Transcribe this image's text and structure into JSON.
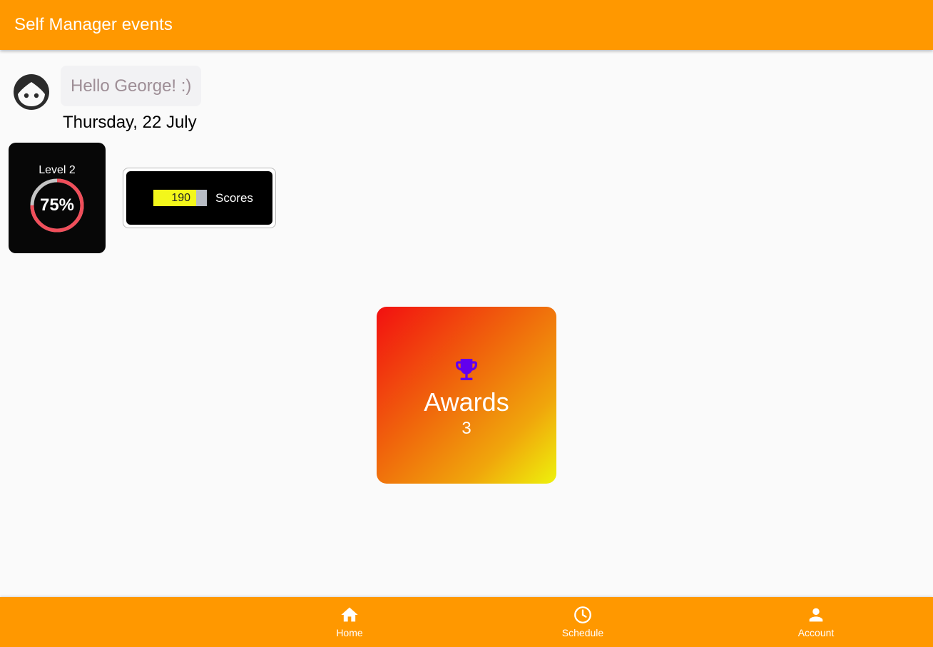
{
  "appbar": {
    "title": "Self Manager events",
    "color": "#ff9800"
  },
  "user": {
    "greeting": "Hello George! :)",
    "date": "Thursday, 22 July",
    "avatar_icon": "face-icon"
  },
  "level": {
    "label": "Level 2",
    "percent_label": "75%",
    "progress": 0.75,
    "ring_color": "#f04e5a",
    "track_color": "#c4c4c4"
  },
  "scores": {
    "value": "190",
    "label": "Scores",
    "bar_fill_fraction": 0.8,
    "fill_color": "#f3f71b"
  },
  "awards": {
    "label": "Awards",
    "count": "3",
    "icon": "trophy-icon",
    "icon_color": "#6200ee"
  },
  "bottom_nav": {
    "items": [
      {
        "label": "Home",
        "icon": "home-icon"
      },
      {
        "label": "Schedule",
        "icon": "clock-icon"
      },
      {
        "label": "Account",
        "icon": "person-icon"
      }
    ]
  }
}
